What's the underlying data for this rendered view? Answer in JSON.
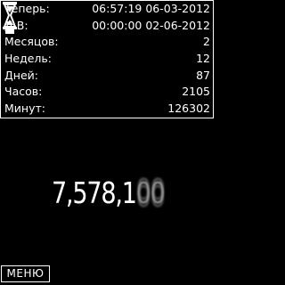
{
  "stats": {
    "rows": [
      {
        "label": "Теперь:",
        "value": "06:57:19 06-03-2012"
      },
      {
        "label": "Д.В:",
        "value": "00:00:00 02-06-2012"
      },
      {
        "label": "Месяцов:",
        "value": "2"
      },
      {
        "label": "Недель:",
        "value": "12"
      },
      {
        "label": "Дней:",
        "value": "87"
      },
      {
        "label": "Часов:",
        "value": "2105"
      },
      {
        "label": "Минут:",
        "value": "126302"
      }
    ]
  },
  "counter": {
    "static_part": "7,578,1",
    "rolling_part": "00"
  },
  "softkeys": {
    "left_label": "МЕНЮ"
  },
  "icons": {
    "status": "hourglass-icon"
  }
}
